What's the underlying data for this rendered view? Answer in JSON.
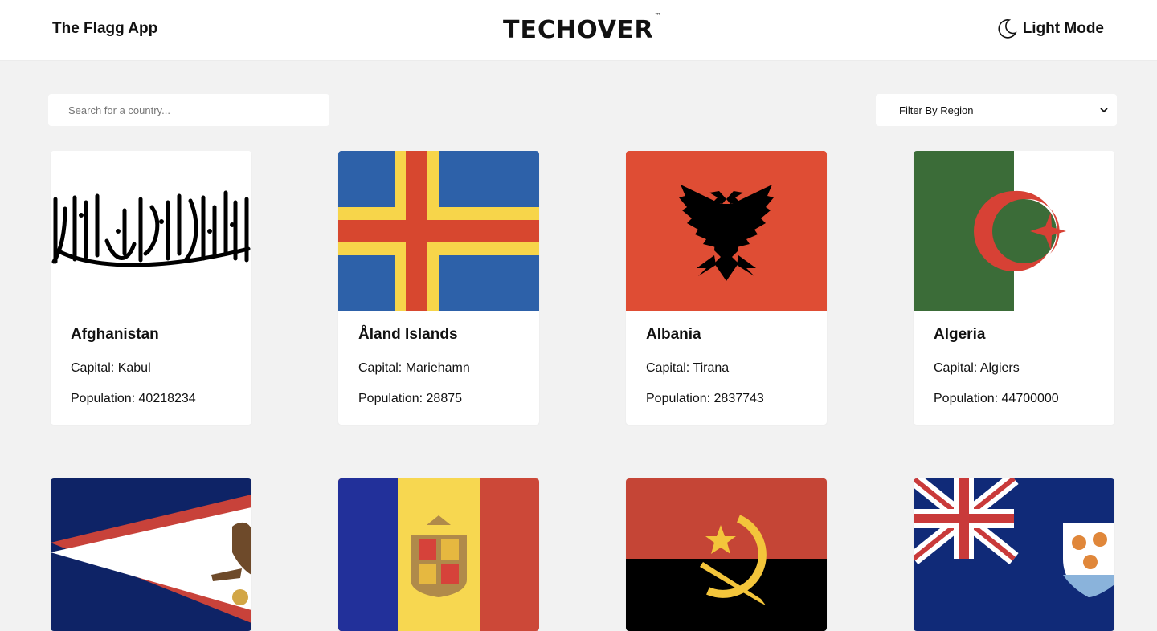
{
  "header": {
    "app_title": "The Flagg App",
    "brand": "TECHOVER",
    "brand_mark": "™",
    "mode_label": "Light Mode",
    "mode_icon": "moon-icon"
  },
  "search": {
    "placeholder": "Search for a country..."
  },
  "filter": {
    "selected": "Filter By Region",
    "icon": "chevron-down-icon"
  },
  "labels": {
    "capital": "Capital:",
    "population": "Population:"
  },
  "countries": [
    {
      "name": "Afghanistan",
      "capital": "Kabul",
      "population": "40218234",
      "flag": "afghanistan-flag"
    },
    {
      "name": "Åland Islands",
      "capital": "Mariehamn",
      "population": "28875",
      "flag": "aland-flag"
    },
    {
      "name": "Albania",
      "capital": "Tirana",
      "population": "2837743",
      "flag": "albania-flag"
    },
    {
      "name": "Algeria",
      "capital": "Algiers",
      "population": "44700000",
      "flag": "algeria-flag"
    },
    {
      "flag": "american-samoa-flag"
    },
    {
      "flag": "andorra-flag"
    },
    {
      "flag": "angola-flag"
    },
    {
      "flag": "anguilla-flag"
    }
  ]
}
